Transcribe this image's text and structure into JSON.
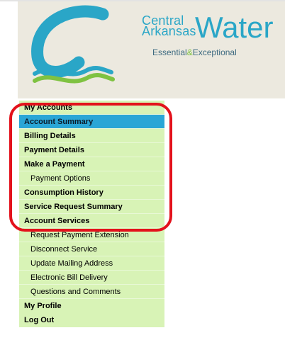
{
  "brand": {
    "line1": "Central",
    "line2": "Arkansas",
    "word": "Water",
    "tagline_a": "Essential",
    "tagline_amp": "&",
    "tagline_b": "Exceptional"
  },
  "colors": {
    "brand_blue": "#2aa6c7",
    "menu_bg": "#d8f3b6",
    "selected_bg": "#2aa6d6",
    "highlight_red": "#e3121c",
    "header_bg": "#ece9df"
  },
  "menu": {
    "my_accounts": "My Accounts",
    "account_summary": "Account Summary",
    "billing_details": "Billing Details",
    "payment_details": "Payment Details",
    "make_a_payment": "Make a Payment",
    "payment_options": "Payment Options",
    "consumption_history": "Consumption History",
    "service_request_summary": "Service Request Summary",
    "account_services": "Account Services",
    "request_payment_extension": "Request Payment Extension",
    "disconnect_service": "Disconnect Service",
    "update_mailing_address": "Update Mailing Address",
    "electronic_bill_delivery": "Electronic Bill Delivery",
    "questions_and_comments": "Questions and Comments",
    "my_profile": "My Profile",
    "log_out": "Log Out"
  }
}
